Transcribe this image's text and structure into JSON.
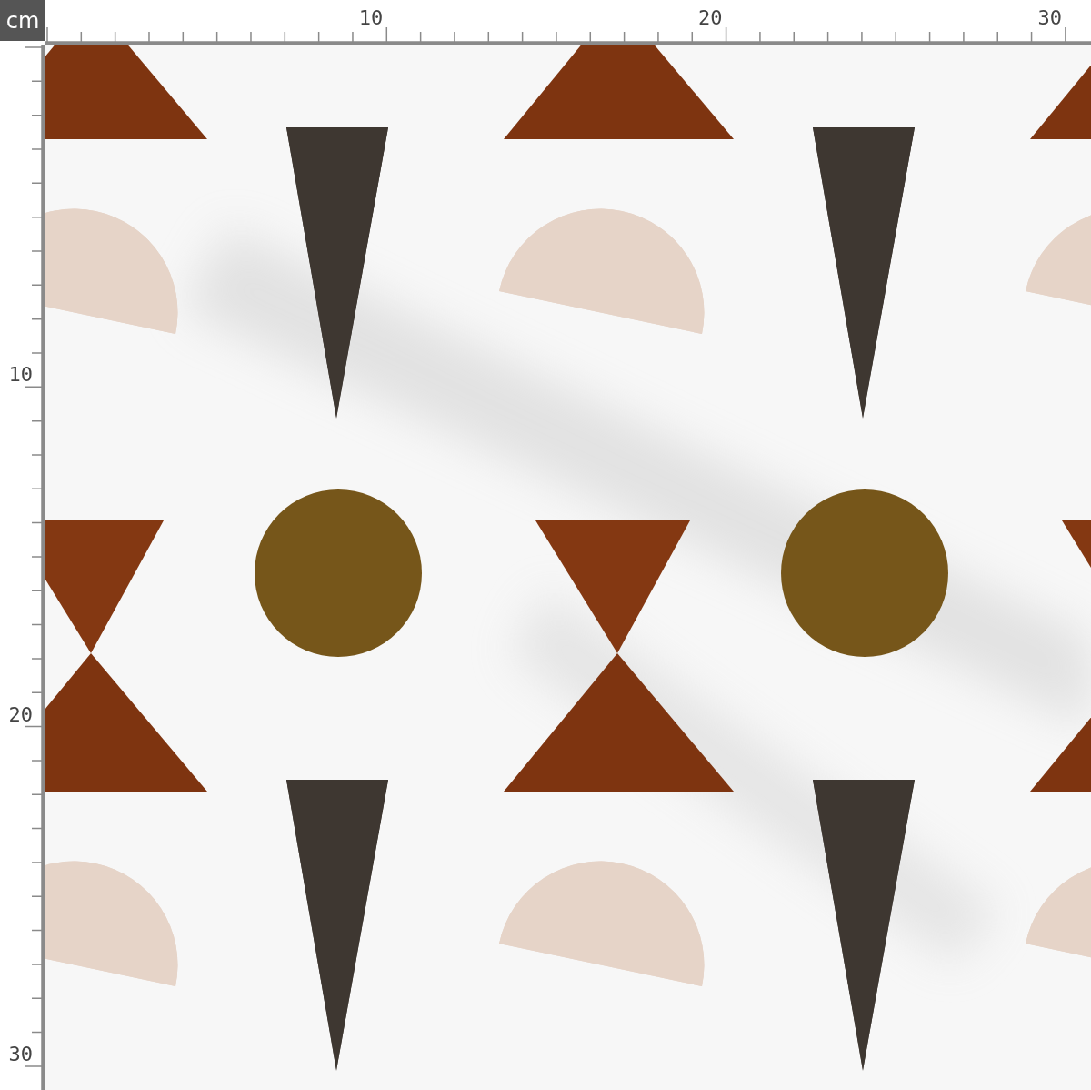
{
  "unit_label": "cm",
  "top_ruler": {
    "labels": [
      "10",
      "20",
      "30"
    ]
  },
  "left_ruler": {
    "labels": [
      "10",
      "20",
      "30"
    ]
  }
}
